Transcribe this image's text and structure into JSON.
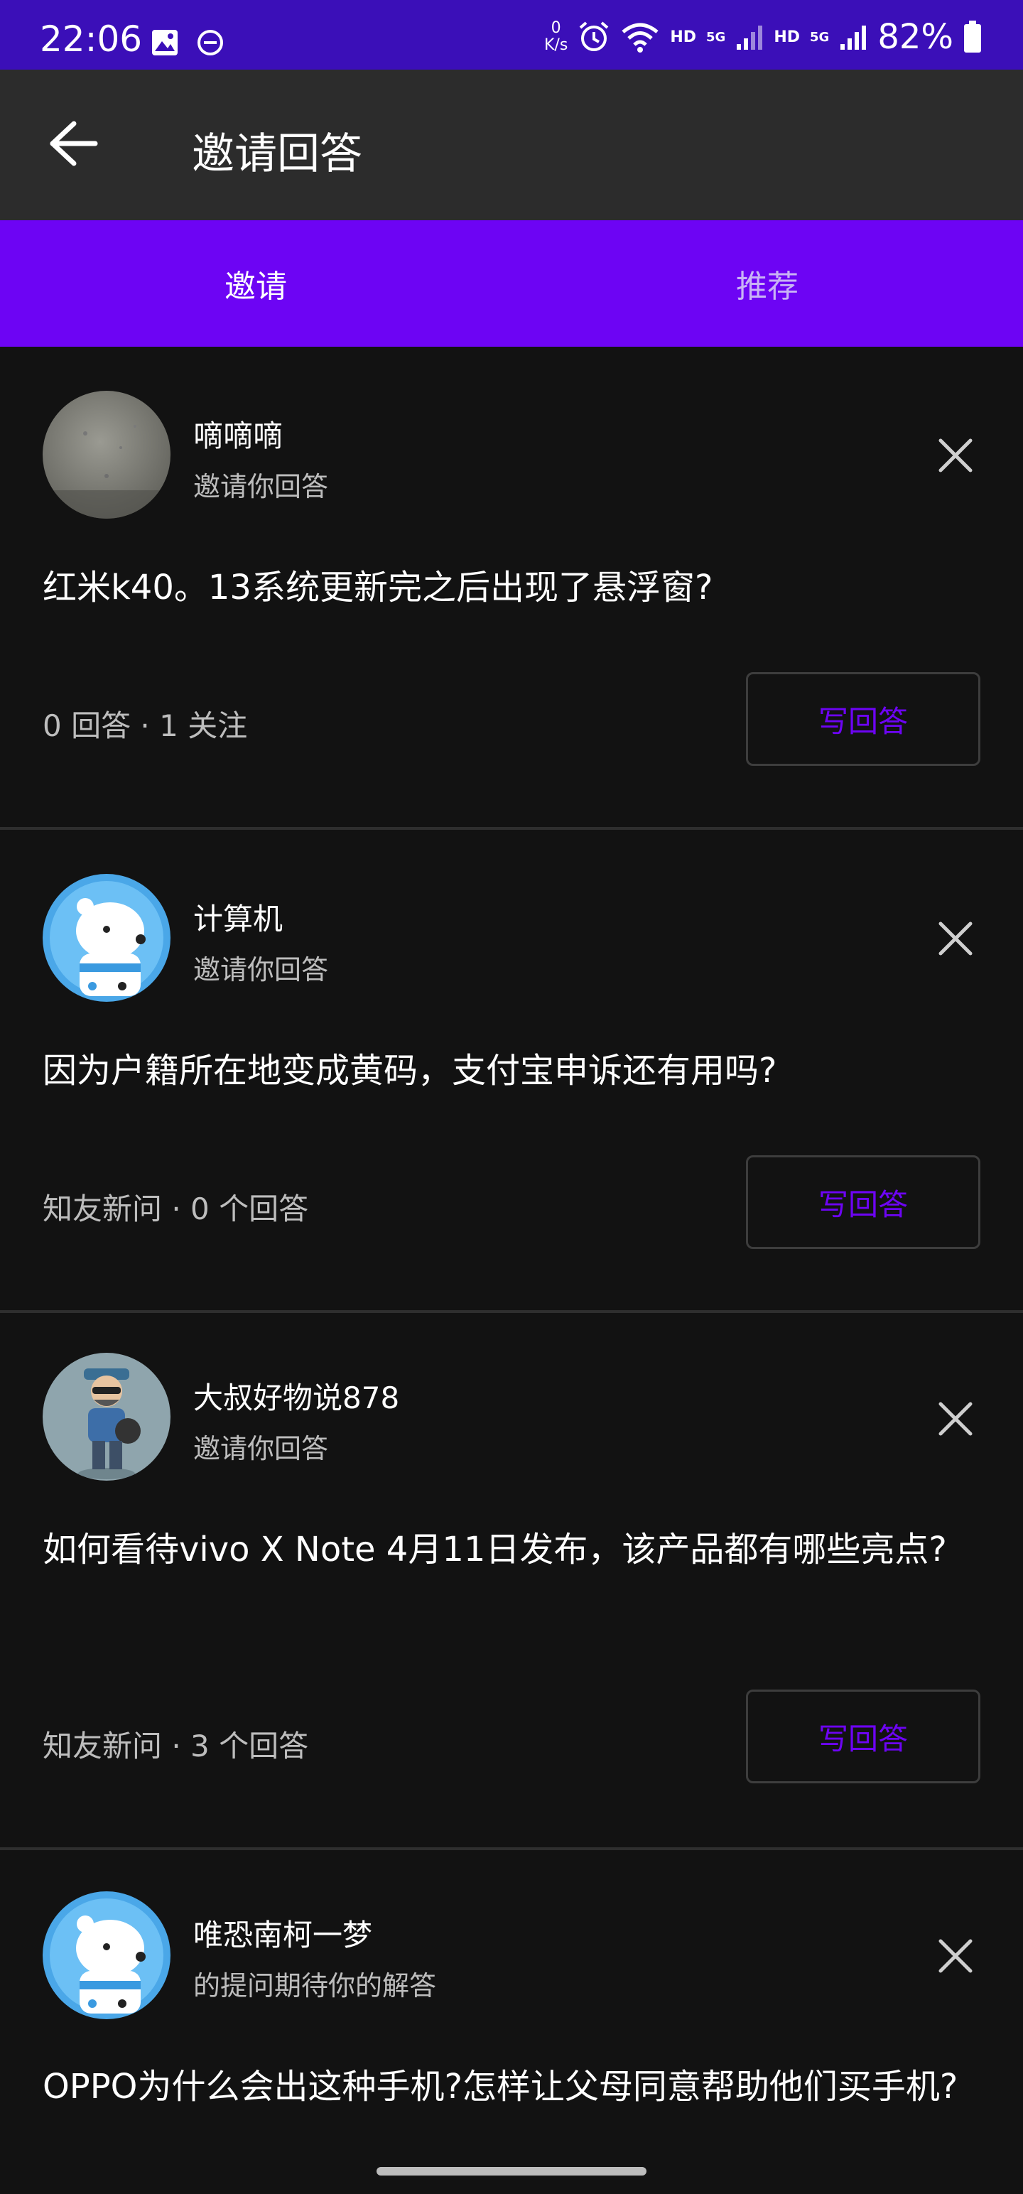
{
  "status_bar": {
    "time": "22:06",
    "speed_value": "0",
    "speed_unit": "K/s",
    "hd1": "HD",
    "net1": "5G",
    "hd2": "HD",
    "net2": "5G",
    "battery": "82%"
  },
  "app_bar": {
    "title": "邀请回答",
    "back_icon": "arrow-left-icon"
  },
  "tabs": [
    {
      "label": "邀请",
      "active": true
    },
    {
      "label": "推荐",
      "active": false
    }
  ],
  "cards": [
    {
      "user": "嘀嘀嘀",
      "subtitle": "邀请你回答",
      "question": "红米k40。13系统更新完之后出现了悬浮窗?",
      "meta": "0 回答 · 1 关注",
      "button": "写回答"
    },
    {
      "user": "计算机",
      "subtitle": "邀请你回答",
      "question": "因为户籍所在地变成黄码，支付宝申诉还有用吗?",
      "meta": "知友新问 · 0 个回答",
      "button": "写回答"
    },
    {
      "user": "大叔好物说878",
      "subtitle": "邀请你回答",
      "question": "如何看待vivo X Note 4月11日发布，该产品都有哪些亮点?",
      "meta": "知友新问 · 3 个回答",
      "button": "写回答"
    },
    {
      "user": "唯恐南柯一梦",
      "subtitle": "的提问期待你的解答",
      "question": "OPPO为什么会出这种手机?怎样让父母同意帮助他们买手机?",
      "meta": "",
      "button": ""
    }
  ],
  "colors": {
    "status_bar": "#3b0fb8",
    "app_bar": "#2c2c2c",
    "tab_bar": "#6d04f4",
    "background": "#121212",
    "accent": "#6d04f4"
  }
}
